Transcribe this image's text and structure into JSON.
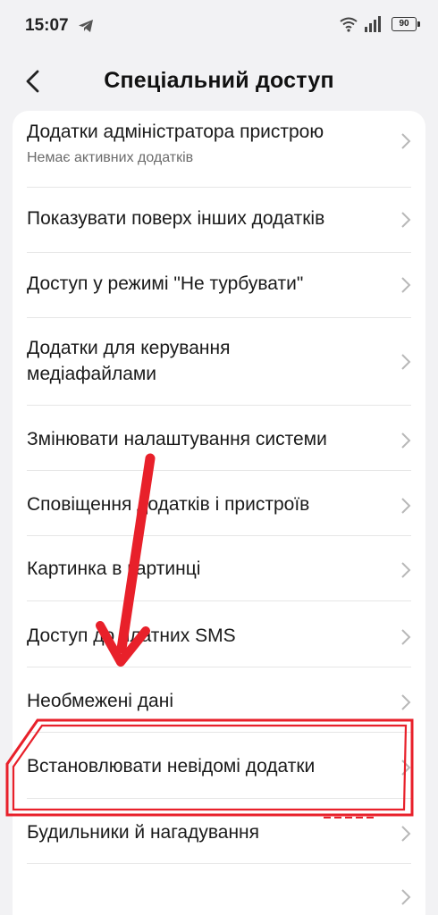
{
  "status_bar": {
    "time": "15:07",
    "battery": "90",
    "icons": [
      "telegram-icon",
      "wifi-icon",
      "signal-icon",
      "battery-icon"
    ]
  },
  "header": {
    "title": "Спеціальний доступ",
    "back_icon": "chevron-left-icon"
  },
  "items": [
    {
      "title": "Додатки адміністратора пристрою",
      "subtitle": "Немає активних додатків"
    },
    {
      "title": "Показувати поверх інших додатків"
    },
    {
      "title": "Доступ у режимі \"Не турбувати\""
    },
    {
      "title_line1": "Додатки для керування",
      "title_line2": "медіафайлами"
    },
    {
      "title": "Змінювати налаштування системи"
    },
    {
      "title": "Сповіщення додатків і пристроїв"
    },
    {
      "title": "Картинка в картинці"
    },
    {
      "title": "Доступ до платних SMS"
    },
    {
      "title": "Необмежені дані"
    },
    {
      "title": "Встановлювати невідомі додатки"
    },
    {
      "title": "Будильники й нагадування"
    }
  ],
  "annotation": {
    "color": "#e8202a"
  }
}
